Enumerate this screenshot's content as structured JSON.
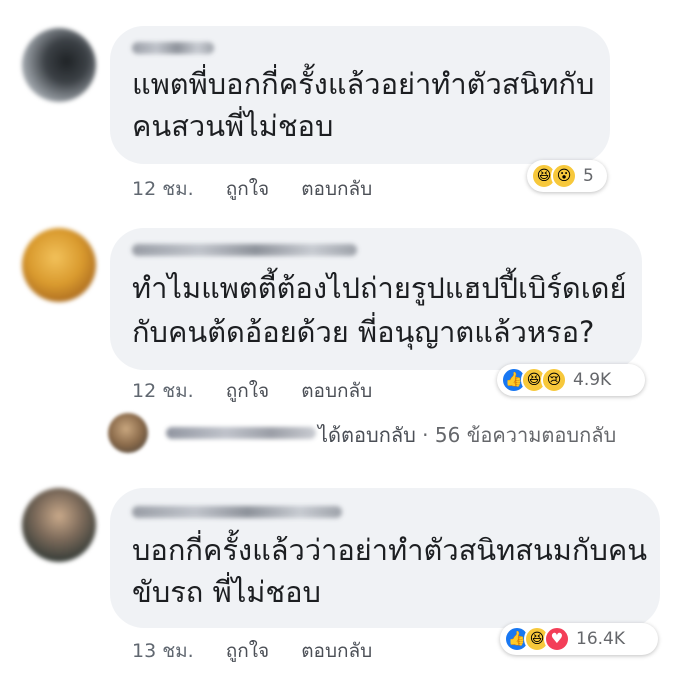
{
  "comments": [
    {
      "text_line1": "แพตพี่บอกกี่ครั้งแล้วอย่าทำตัวสนิทกับ",
      "text_line2": "คนสวนพี่ไม่ชอบ",
      "time": "12 ชม.",
      "like_label": "ถูกใจ",
      "reply_label": "ตอบกลับ",
      "reactions": [
        "haha",
        "wow"
      ],
      "reaction_count": "5"
    },
    {
      "text_line1": "ทำไมแพตตี้ต้องไปถ่ายรูปแฮปปี้เบิร์ดเดย์",
      "text_line2": "กับคนต้ดอ้อยด้วย พี่อนุญาตแล้วหรอ?",
      "time": "12 ชม.",
      "like_label": "ถูกใจ",
      "reply_label": "ตอบกลับ",
      "reactions": [
        "like",
        "haha",
        "sad"
      ],
      "reaction_count": "4.9K"
    },
    {
      "text_line1": "บอกกี่ครั้งแล้วว่าอย่าทำตัวสนิทสนมกับคน",
      "text_line2": "ขับรถ พี่ไม่ชอบ",
      "time": "13 ชม.",
      "like_label": "ถูกใจ",
      "reply_label": "ตอบกลับ",
      "reactions": [
        "like",
        "haha",
        "love"
      ],
      "reaction_count": "16.4K"
    }
  ],
  "reply_summary": {
    "replied_label": "ได้ตอบกลับ",
    "separator": "·",
    "count_label": "56 ข้อความตอบกลับ"
  },
  "colors": {
    "bubble": "#f0f2f5",
    "like": "#1877f2",
    "love": "#f33e58",
    "emoji": "#f7c83b"
  },
  "icons": {
    "like": "thumbs-up-icon",
    "haha": "laughing-face-icon",
    "wow": "surprised-face-icon",
    "sad": "crying-face-icon",
    "love": "heart-icon"
  }
}
